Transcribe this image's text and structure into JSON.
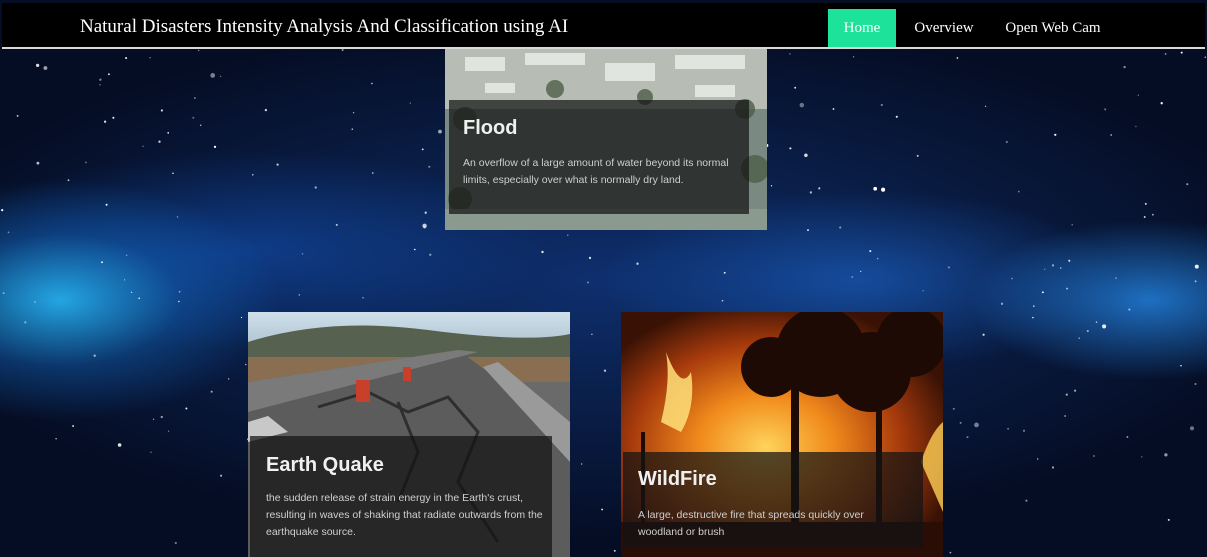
{
  "navbar": {
    "brand": "Natural Disasters Intensity Analysis And Classification using AI",
    "items": [
      {
        "label": "Home",
        "active": true
      },
      {
        "label": "Overview",
        "active": false
      },
      {
        "label": "Open Web Cam",
        "active": false
      }
    ],
    "active_color": "#1de39a"
  },
  "cards": [
    {
      "title": "Flood",
      "description": "An overflow of a large amount of water beyond its normal limits, especially over what is normally dry land.",
      "image": "flooded-town-photo"
    },
    {
      "title": "Earth Quake",
      "description": "the sudden release of strain energy in the Earth's crust, resulting in waves of shaking that radiate outwards from the earthquake source.",
      "image": "cracked-road-photo"
    },
    {
      "title": "WildFire",
      "description": "A large, destructive fire that spreads quickly over woodland or brush",
      "image": "forest-fire-photo"
    }
  ]
}
